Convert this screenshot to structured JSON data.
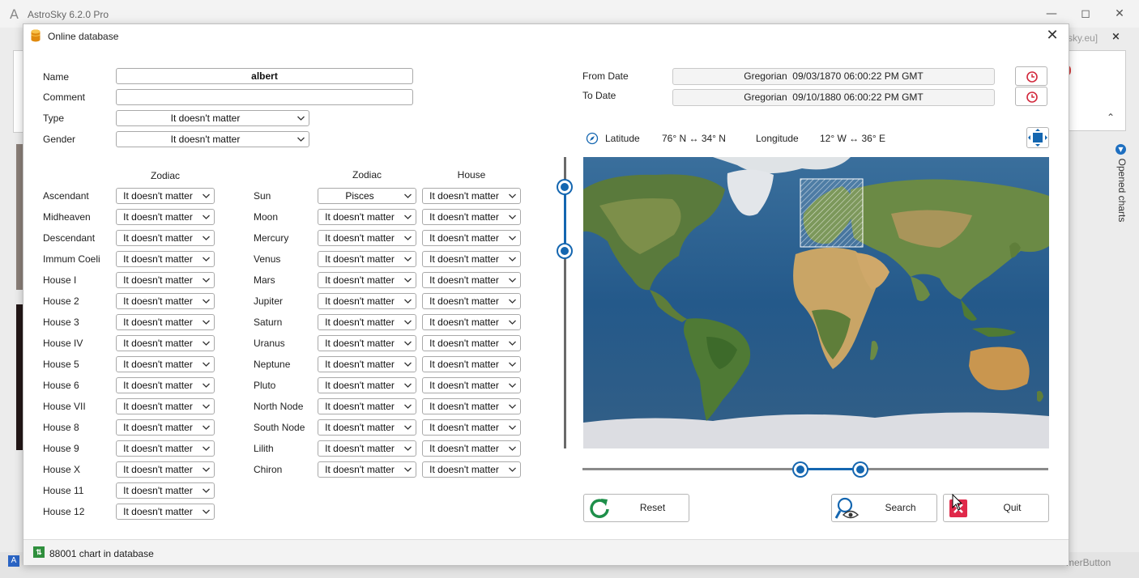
{
  "app": {
    "logo_glyph": "A",
    "title": "AstroSky 6.2.0 Pro",
    "url_fragment": "sky.eu]",
    "url_close": "×",
    "opened_charts_label": "Opened charts",
    "bottom_right_text": "merButton"
  },
  "dialog": {
    "title": "Online database",
    "close_glyph": "✕",
    "status_text": "88001 chart in database"
  },
  "form": {
    "name_label": "Name",
    "name_value": "albert",
    "comment_label": "Comment",
    "comment_value": "",
    "type_label": "Type",
    "type_value": "It doesn't matter",
    "gender_label": "Gender",
    "gender_value": "It doesn't matter"
  },
  "points": {
    "zodiac_header": "Zodiac",
    "items": [
      {
        "label": "Ascendant",
        "zodiac": "It doesn't matter"
      },
      {
        "label": "Midheaven",
        "zodiac": "It doesn't matter"
      },
      {
        "label": "Descendant",
        "zodiac": "It doesn't matter"
      },
      {
        "label": "Immum Coeli",
        "zodiac": "It doesn't matter"
      },
      {
        "label": "House I",
        "zodiac": "It doesn't matter"
      },
      {
        "label": "House 2",
        "zodiac": "It doesn't matter"
      },
      {
        "label": "House 3",
        "zodiac": "It doesn't matter"
      },
      {
        "label": "House IV",
        "zodiac": "It doesn't matter"
      },
      {
        "label": "House 5",
        "zodiac": "It doesn't matter"
      },
      {
        "label": "House 6",
        "zodiac": "It doesn't matter"
      },
      {
        "label": "House VII",
        "zodiac": "It doesn't matter"
      },
      {
        "label": "House 8",
        "zodiac": "It doesn't matter"
      },
      {
        "label": "House 9",
        "zodiac": "It doesn't matter"
      },
      {
        "label": "House X",
        "zodiac": "It doesn't matter"
      },
      {
        "label": "House 11",
        "zodiac": "It doesn't matter"
      },
      {
        "label": "House 12",
        "zodiac": "It doesn't matter"
      }
    ]
  },
  "planets": {
    "zodiac_header": "Zodiac",
    "house_header": "House",
    "items": [
      {
        "label": "Sun",
        "zodiac": "Pisces",
        "house": "It doesn't matter"
      },
      {
        "label": "Moon",
        "zodiac": "It doesn't matter",
        "house": "It doesn't matter"
      },
      {
        "label": "Mercury",
        "zodiac": "It doesn't matter",
        "house": "It doesn't matter"
      },
      {
        "label": "Venus",
        "zodiac": "It doesn't matter",
        "house": "It doesn't matter"
      },
      {
        "label": "Mars",
        "zodiac": "It doesn't matter",
        "house": "It doesn't matter"
      },
      {
        "label": "Jupiter",
        "zodiac": "It doesn't matter",
        "house": "It doesn't matter"
      },
      {
        "label": "Saturn",
        "zodiac": "It doesn't matter",
        "house": "It doesn't matter"
      },
      {
        "label": "Uranus",
        "zodiac": "It doesn't matter",
        "house": "It doesn't matter"
      },
      {
        "label": "Neptune",
        "zodiac": "It doesn't matter",
        "house": "It doesn't matter"
      },
      {
        "label": "Pluto",
        "zodiac": "It doesn't matter",
        "house": "It doesn't matter"
      },
      {
        "label": "North Node",
        "zodiac": "It doesn't matter",
        "house": "It doesn't matter"
      },
      {
        "label": "South Node",
        "zodiac": "It doesn't matter",
        "house": "It doesn't matter"
      },
      {
        "label": "Lilith",
        "zodiac": "It doesn't matter",
        "house": "It doesn't matter"
      },
      {
        "label": "Chiron",
        "zodiac": "It doesn't matter",
        "house": "It doesn't matter"
      }
    ]
  },
  "dates": {
    "from_label": "From Date",
    "from_value": "Gregorian  09/03/1870 06:00:22 PM GMT",
    "to_label": "To Date",
    "to_value": "Gregorian  09/10/1880 06:00:22 PM GMT"
  },
  "geo": {
    "latitude_label": "Latitude",
    "latitude_range": "76° N ↔ 34° N",
    "longitude_label": "Longitude",
    "longitude_range": "12° W ↔ 36° E"
  },
  "actions": {
    "reset_label": "Reset",
    "search_label": "Search",
    "quit_label": "Quit"
  },
  "icons": {
    "dialog": "database-icon",
    "date_picker": "clock-icon",
    "compass": "compass-icon",
    "expand": "expand-icon",
    "reset": "reset-icon",
    "search": "search-eye-icon",
    "quit": "quit-icon"
  },
  "colors": {
    "accent": "#1466b0",
    "quit_red": "#e0294a",
    "reset_green": "#1e8f4a",
    "status_green": "#2f8f3d"
  }
}
